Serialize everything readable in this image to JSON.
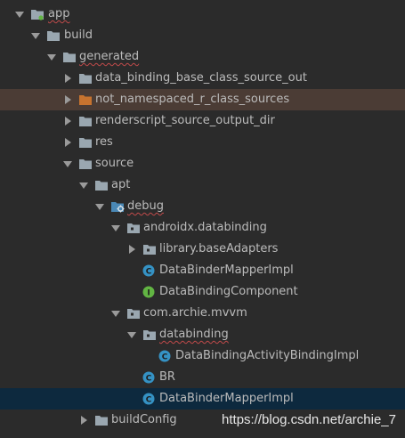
{
  "tree": {
    "rows": [
      {
        "label": "app",
        "expanded": true,
        "icon": "module-folder-icon"
      },
      {
        "label": "build",
        "expanded": true,
        "icon": "folder-icon"
      },
      {
        "label": "generated",
        "expanded": true,
        "icon": "folder-icon"
      },
      {
        "label": "data_binding_base_class_source_out",
        "expanded": false,
        "icon": "folder-icon"
      },
      {
        "label": "not_namespaced_r_class_sources",
        "expanded": false,
        "icon": "excluded-folder-icon"
      },
      {
        "label": "renderscript_source_output_dir",
        "expanded": false,
        "icon": "folder-icon"
      },
      {
        "label": "res",
        "expanded": false,
        "icon": "folder-icon"
      },
      {
        "label": "source",
        "expanded": true,
        "icon": "folder-icon"
      },
      {
        "label": "apt",
        "expanded": true,
        "icon": "folder-icon"
      },
      {
        "label": "debug",
        "expanded": true,
        "icon": "generated-sources-folder-icon"
      },
      {
        "label": "androidx.databinding",
        "expanded": true,
        "icon": "package-icon"
      },
      {
        "label": "library.baseAdapters",
        "expanded": false,
        "icon": "package-icon"
      },
      {
        "label": "DataBinderMapperImpl",
        "icon": "class-icon",
        "badge": "C"
      },
      {
        "label": "DataBindingComponent",
        "icon": "interface-icon",
        "badge": "I"
      },
      {
        "label": "com.archie.mvvm",
        "expanded": true,
        "icon": "package-icon"
      },
      {
        "label": "databinding",
        "expanded": true,
        "icon": "package-icon"
      },
      {
        "label": "DataBindingActivityBindingImpl",
        "icon": "class-icon",
        "badge": "C"
      },
      {
        "label": "BR",
        "icon": "class-icon",
        "badge": "C"
      },
      {
        "label": "DataBinderMapperImpl",
        "icon": "class-icon",
        "badge": "C"
      },
      {
        "label": "buildConfig",
        "expanded": false,
        "icon": "folder-icon"
      }
    ]
  },
  "watermark": "https://blog.csdn.net/archie_7",
  "colors": {
    "background": "#2b2b2b",
    "highlight_row": "#4b3c35",
    "selected_row": "#0d293e",
    "text": "#bbbbbb",
    "class_icon": "#3592c4",
    "interface_icon": "#62b543",
    "excluded_folder": "#c7732f",
    "folder": "#9aa7b0"
  }
}
